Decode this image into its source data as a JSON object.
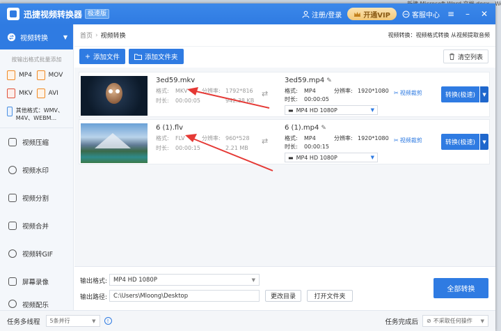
{
  "desktop": {
    "right_text": "新建 Microsoft Word 文档.docx - Word(产品"
  },
  "title_bar": {
    "app_name": "迅捷视频转换器",
    "badge": "极速版",
    "login": "注册/登录",
    "vip": "开通VIP",
    "support": "客服中心",
    "icons": [
      "user-icon",
      "crown-icon",
      "chat-icon",
      "menu-icon",
      "minimize-icon",
      "close-icon"
    ]
  },
  "sidebar": {
    "active": "视频转换",
    "hint": "按输出格式批量添加",
    "formats": [
      {
        "label": "MP4",
        "color": "#f08a24"
      },
      {
        "label": "MOV",
        "color": "#f08a24"
      },
      {
        "label": "MKV",
        "color": "#e0523a"
      },
      {
        "label": "AVI",
        "color": "#f08a24"
      }
    ],
    "other_formats": "其他格式：WMV、M4V、WEBM...",
    "items": [
      {
        "label": "视频压缩",
        "icon": "compress-icon"
      },
      {
        "label": "视频水印",
        "icon": "watermark-icon"
      },
      {
        "label": "视频分割",
        "icon": "split-icon"
      },
      {
        "label": "视频合并",
        "icon": "merge-icon"
      },
      {
        "label": "视频转GIF",
        "icon": "gif-icon"
      },
      {
        "label": "屏幕录像",
        "icon": "record-icon"
      },
      {
        "label": "视频配乐",
        "icon": "music-icon"
      }
    ]
  },
  "breadcrumb": {
    "home": "首页",
    "current": "视频转换",
    "description": "视频转换：视频格式转换 从视频提取音频"
  },
  "toolbar": {
    "add_file": "添加文件",
    "add_folder": "添加文件夹",
    "clear_list": "清空列表"
  },
  "labels": {
    "format": "格式:",
    "resolution": "分辨率:",
    "duration": "时长:",
    "cut": "视频裁剪",
    "convert": "转换(极速)"
  },
  "files": [
    {
      "source_name": "3ed59.mkv",
      "source_format": "MKV",
      "source_resolution": "1792*816",
      "source_duration": "00:00:05",
      "source_size": "942.38 KB",
      "target_name": "3ed59.mp4",
      "target_format": "MP4",
      "target_resolution": "1920*1080",
      "target_duration": "00:00:05",
      "preset": "MP4  HD 1080P"
    },
    {
      "source_name": "6 (1).flv",
      "source_format": "FLV",
      "source_resolution": "960*528",
      "source_duration": "00:00:15",
      "source_size": "2.21 MB",
      "target_name": "6 (1).mp4",
      "target_format": "MP4",
      "target_resolution": "1920*1080",
      "target_duration": "00:00:15",
      "preset": "MP4  HD 1080P"
    }
  ],
  "output": {
    "format_label": "输出格式:",
    "format_value": "MP4  HD 1080P",
    "path_label": "输出路径:",
    "path_value": "C:\\Users\\Mloong\\Desktop",
    "change_dir": "更改目录",
    "open_folder": "打开文件夹",
    "convert_all": "全部转换"
  },
  "status_bar": {
    "threads_label": "任务多线程",
    "threads_value": "5条并行",
    "after_label": "任务完成后",
    "after_value": "不采取任何操作"
  },
  "colors": {
    "accent": "#2f7be2",
    "annotation_arrow": "#e53935",
    "vip_gold": "#f2c878"
  }
}
